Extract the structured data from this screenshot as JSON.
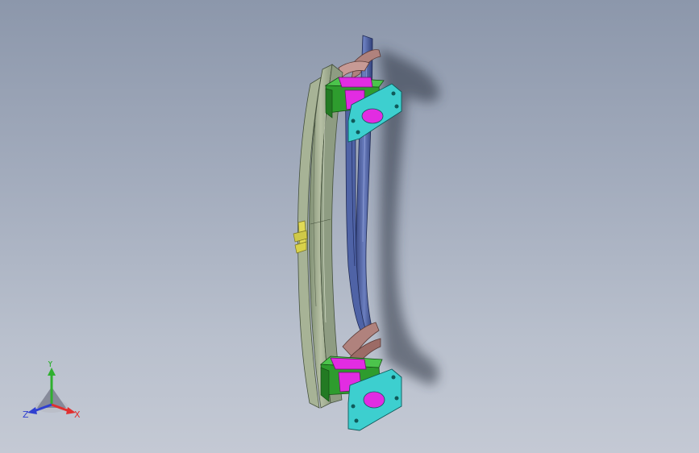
{
  "viewport": {
    "background_top": "#8c97ab",
    "background_bottom": "#c4c9d4"
  },
  "model": {
    "parts": [
      {
        "name": "bumper-beam",
        "color": "#9aa88a"
      },
      {
        "name": "reinforcement-rail",
        "color": "#4a5a9a"
      },
      {
        "name": "crash-box",
        "color": "#2fa32f"
      },
      {
        "name": "mounting-plate",
        "color": "#37c6c6"
      },
      {
        "name": "bracket",
        "color": "#a77470"
      },
      {
        "name": "insert",
        "color": "#e22ce2"
      },
      {
        "name": "tow-hook-clip",
        "color": "#d8d24a"
      }
    ]
  },
  "triad": {
    "x_label": "X",
    "y_label": "Y",
    "z_label": "Z",
    "x_color": "#e03030",
    "y_color": "#2fb02f",
    "z_color": "#3040d0"
  }
}
